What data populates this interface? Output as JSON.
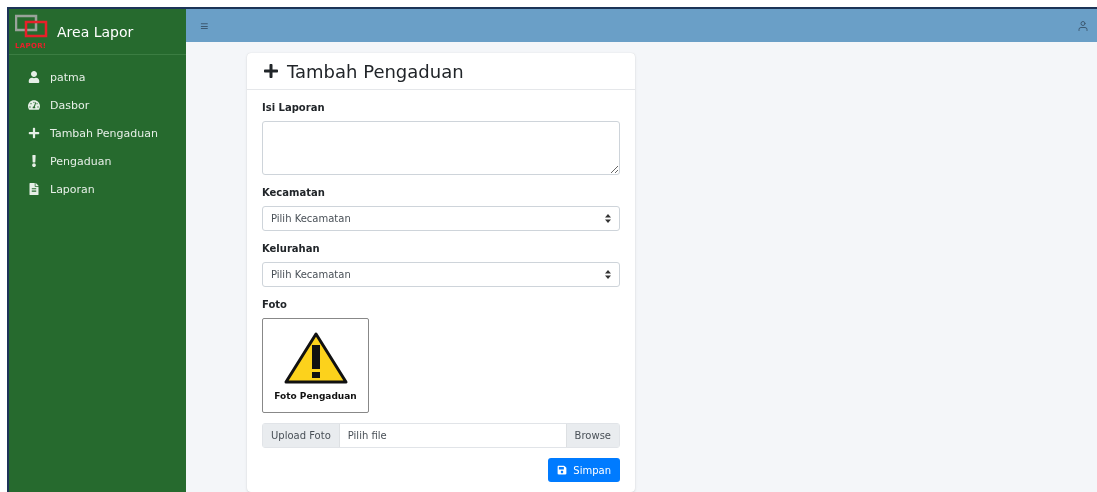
{
  "brand": {
    "logo_text": "LAPOR!",
    "title": "Area Lapor"
  },
  "sidebar": {
    "items": [
      {
        "label": "patma"
      },
      {
        "label": "Dasbor"
      },
      {
        "label": "Tambah Pengaduan"
      },
      {
        "label": "Pengaduan"
      },
      {
        "label": "Laporan"
      }
    ]
  },
  "topbar": {
    "menu": "≡"
  },
  "card": {
    "title": "Tambah Pengaduan",
    "fields": [
      {
        "kind": "textarea",
        "label": "Isi Laporan"
      },
      {
        "kind": "select",
        "label": "Kecamatan",
        "value": "Pilih Kecamatan"
      },
      {
        "kind": "select",
        "label": "Kelurahan",
        "value": "Pilih Kecamatan"
      },
      {
        "kind": "photo",
        "label": "Foto",
        "caption": "Foto Pengaduan"
      },
      {
        "kind": "file",
        "prefix": "Upload Foto",
        "placeholder": "Pilih file",
        "button": "Browse"
      }
    ],
    "submit": "Simpan"
  }
}
